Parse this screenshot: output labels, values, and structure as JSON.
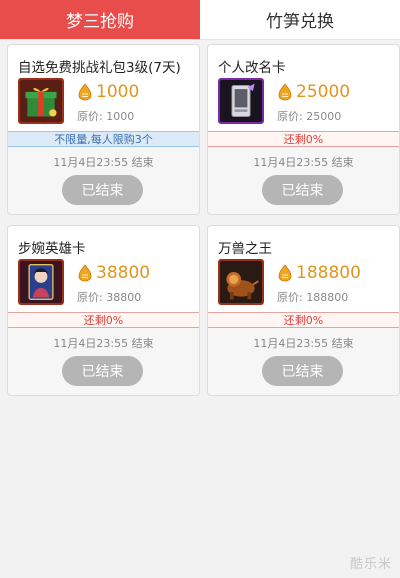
{
  "tabs": [
    {
      "label": "梦三抢购",
      "active": true
    },
    {
      "label": "竹笋兑换",
      "active": false
    }
  ],
  "colors": {
    "accent": "#e84d4c",
    "price": "#e0951f",
    "status_red": "#e23e3a",
    "status_blue": "#3a6fb0",
    "button_ended": "#b5b5b5"
  },
  "cards": [
    {
      "title": "自选免费挑战礼包3级(7天)",
      "thumb_icon": "gift-box-icon",
      "price": "1000",
      "orig_label": "原价:",
      "orig_value": "1000",
      "status": "不限量,每人限购3个",
      "end_time": "11月4日23:55 结束",
      "button_label": "已结束"
    },
    {
      "title": "个人改名卡",
      "thumb_icon": "rename-card-icon",
      "price": "25000",
      "orig_label": "原价:",
      "orig_value": "25000",
      "status": "还剩0%",
      "end_time": "11月4日23:55 结束",
      "button_label": "已结束"
    },
    {
      "title": "步婉英雄卡",
      "thumb_icon": "hero-card-icon",
      "price": "38800",
      "orig_label": "原价:",
      "orig_value": "38800",
      "status": "还剩0%",
      "end_time": "11月4日23:55 结束",
      "button_label": "已结束"
    },
    {
      "title": "万兽之王",
      "thumb_icon": "beast-king-icon",
      "price": "188800",
      "orig_label": "原价:",
      "orig_value": "188800",
      "status": "还剩0%",
      "end_time": "11月4日23:55 结束",
      "button_label": "已结束"
    }
  ],
  "watermark": "酷乐米"
}
